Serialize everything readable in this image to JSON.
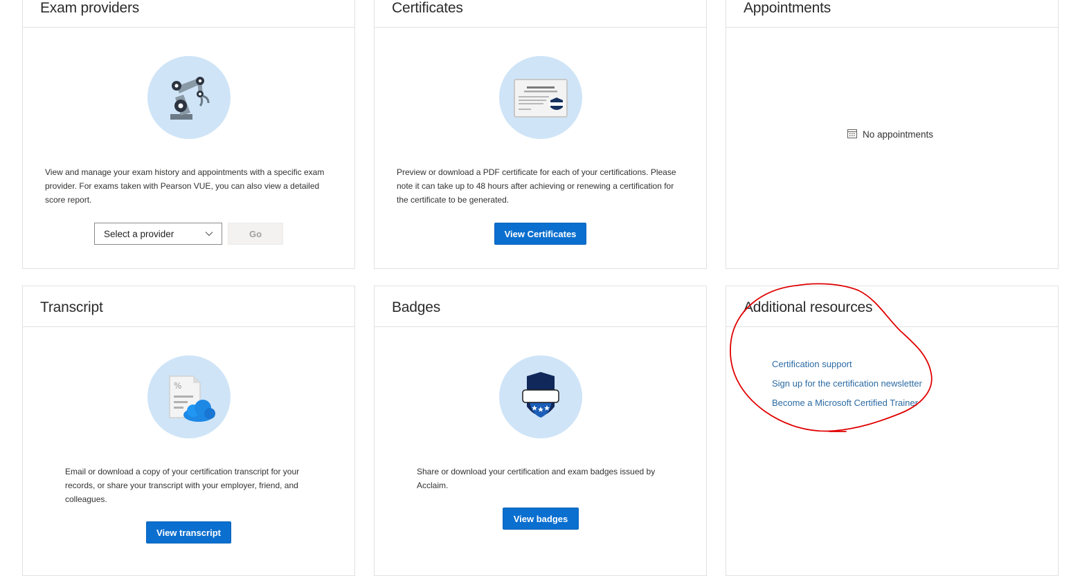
{
  "cards": {
    "exam_providers": {
      "title": "Exam providers",
      "description": "View and manage your exam history and appointments with a specific exam provider. For exams taken with Pearson VUE, you can also view a detailed score report.",
      "select_placeholder": "Select a provider",
      "go_label": "Go",
      "illustration": "robot-arm-icon"
    },
    "certificates": {
      "title": "Certificates",
      "description": "Preview or download a PDF certificate for each of your certifications. Please note it can take up to 48 hours after achieving or renewing a certification for the certificate to be generated.",
      "button_label": "View Certificates",
      "illustration": "certificate-icon"
    },
    "appointments": {
      "title": "Appointments",
      "empty_text": "No appointments",
      "icon": "calendar-icon"
    },
    "transcript": {
      "title": "Transcript",
      "description": "Email or download a copy of your certification transcript for your records, or share your transcript with your employer, friend, and colleagues.",
      "button_label": "View transcript",
      "illustration": "document-cloud-icon"
    },
    "badges": {
      "title": "Badges",
      "description": "Share or download your certification and exam badges issued by Acclaim.",
      "button_label": "View badges",
      "illustration": "badge-shield-icon"
    },
    "additional_resources": {
      "title": "Additional resources",
      "links": [
        "Certification support",
        "Sign up for the certification newsletter",
        "Become a Microsoft Certified Trainer"
      ]
    }
  },
  "colors": {
    "primary_button": "#0b6fcf",
    "link": "#2b6aa3",
    "illustration_bg": "#cfe4f7",
    "annotation": "#e00000"
  }
}
